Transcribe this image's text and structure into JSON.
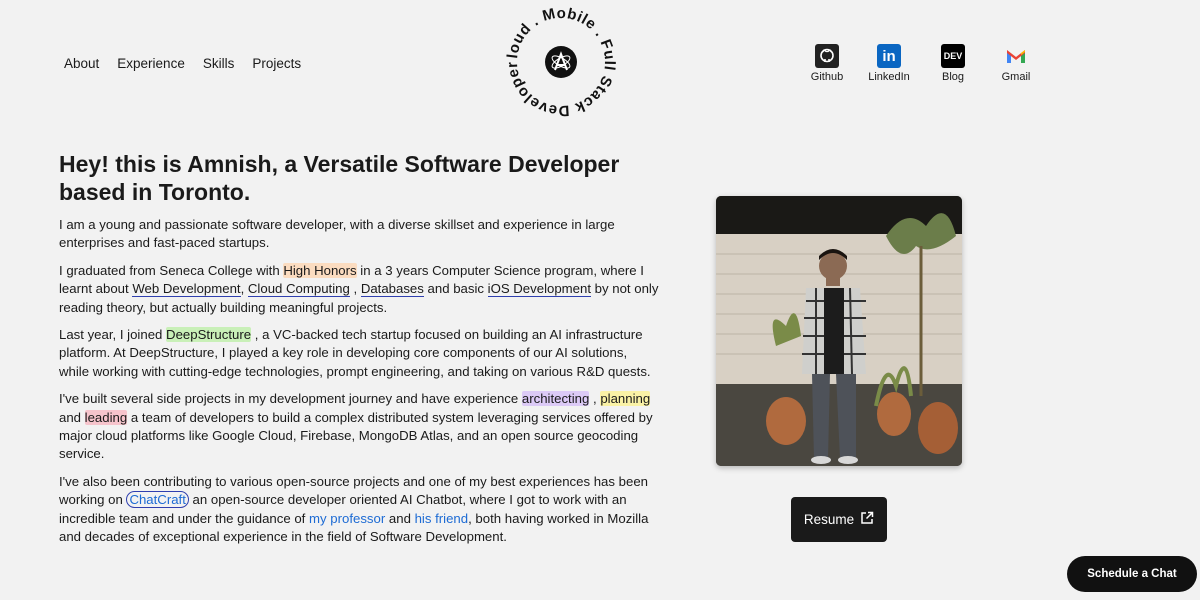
{
  "nav": {
    "items": [
      "About",
      "Experience",
      "Skills",
      "Projects"
    ]
  },
  "logo": {
    "ring_text": "Cloud . Mobile . Full Stack Developer .",
    "icon": "atom-a-icon"
  },
  "socials": [
    {
      "label": "Github",
      "icon": "github-icon",
      "color": "#222222"
    },
    {
      "label": "LinkedIn",
      "icon": "linkedin-icon",
      "color": "#0a66c2"
    },
    {
      "label": "Blog",
      "icon": "dev-icon",
      "icon_text": "DEV",
      "color": "#000000"
    },
    {
      "label": "Gmail",
      "icon": "gmail-icon",
      "color": "#ea4335"
    }
  ],
  "hero": {
    "title_line1": "Hey! this is Amnish, a Versatile Software Developer",
    "title_line2": "based in Toronto."
  },
  "bio": {
    "p1": "I am a young and passionate software developer, with a diverse skillset and experience in large enterprises and fast-paced startups.",
    "p2": {
      "t1": "I graduated from Seneca College with ",
      "honors": "High Honors",
      "t2": " in a 3 years Computer Science program, where I learnt about ",
      "webdev": "Web Development",
      "t3": ", ",
      "cloud": "Cloud Computing",
      "t4": " , ",
      "db": "Databases",
      "t5": " and basic ",
      "ios": "iOS Development",
      "t6": " by not only reading theory, but actually building meaningful projects."
    },
    "p3": {
      "t1": "Last year, I joined ",
      "company": "DeepStructure",
      "t2": " , a VC-backed tech startup focused on building an AI infrastructure platform. At DeepStructure, I played a key role in developing core components of our AI solutions, while working with cutting-edge technologies, prompt engineering, and taking on various R&D quests."
    },
    "p4": {
      "t1": "I've built several side projects in my development journey and have experience ",
      "architecting": "architecting",
      "t2": " , ",
      "planning": "planning",
      "t3": " and ",
      "leading": "leading",
      "t4": " a team of developers to build a complex distributed system leveraging services offered by major cloud platforms like Google Cloud, Firebase, MongoDB Atlas, and an open source geocoding service."
    },
    "p5": {
      "t1": "I've also been contributing to various open-source projects and one of my best experiences has been working on ",
      "chatcraft": "ChatCraft",
      "t2": " an open-source developer oriented AI Chatbot, where I got to work with an incredible team and under the guidance of ",
      "professor": "my professor",
      "t3": " and ",
      "friend": "his friend",
      "t4": ", both having worked in Mozilla and decades of exceptional experience in the field of Software Development."
    }
  },
  "buttons": {
    "resume": "Resume",
    "chat": "Schedule a Chat"
  },
  "colors": {
    "background": "#f2f2f2",
    "link": "#1d6bd4",
    "button": "#1a1a1a"
  }
}
